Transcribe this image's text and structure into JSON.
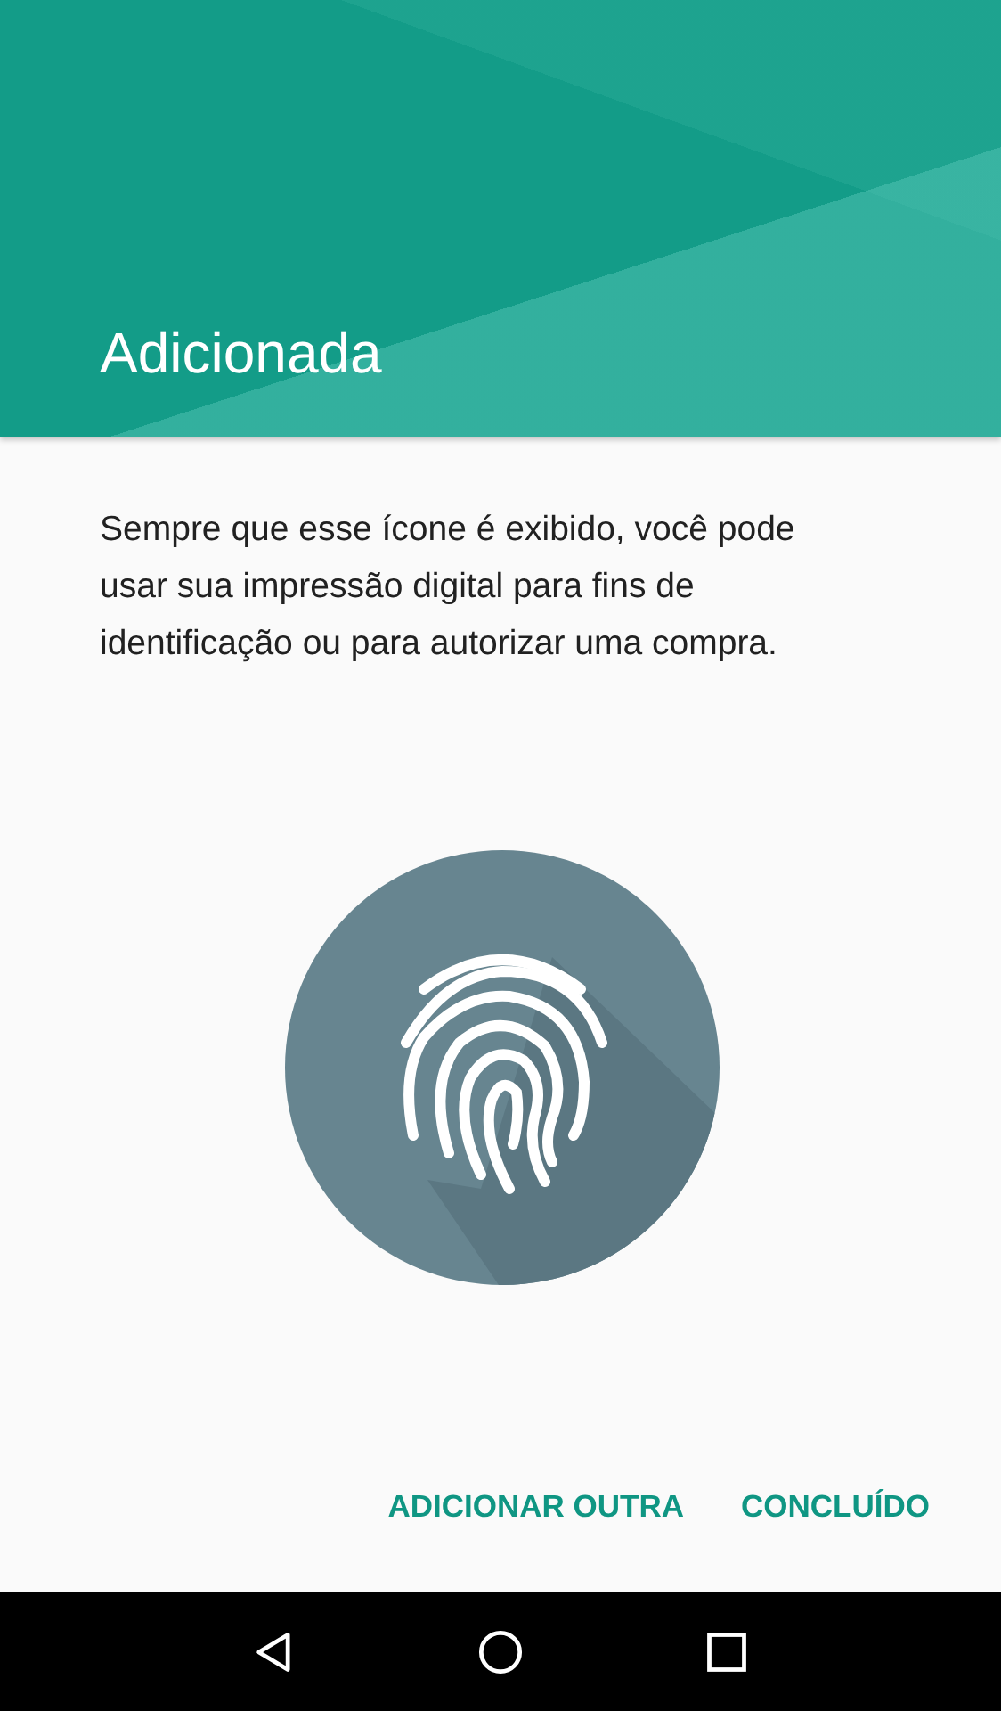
{
  "header": {
    "title": "Adicionada"
  },
  "description": "Sempre que esse ícone é exibido, você pode usar sua impressão digital para fins de identificação ou para autorizar uma compra.",
  "buttons": [
    {
      "label": "ADICIONAR OUTRA"
    },
    {
      "label": "CONCLUÍDO"
    }
  ]
}
